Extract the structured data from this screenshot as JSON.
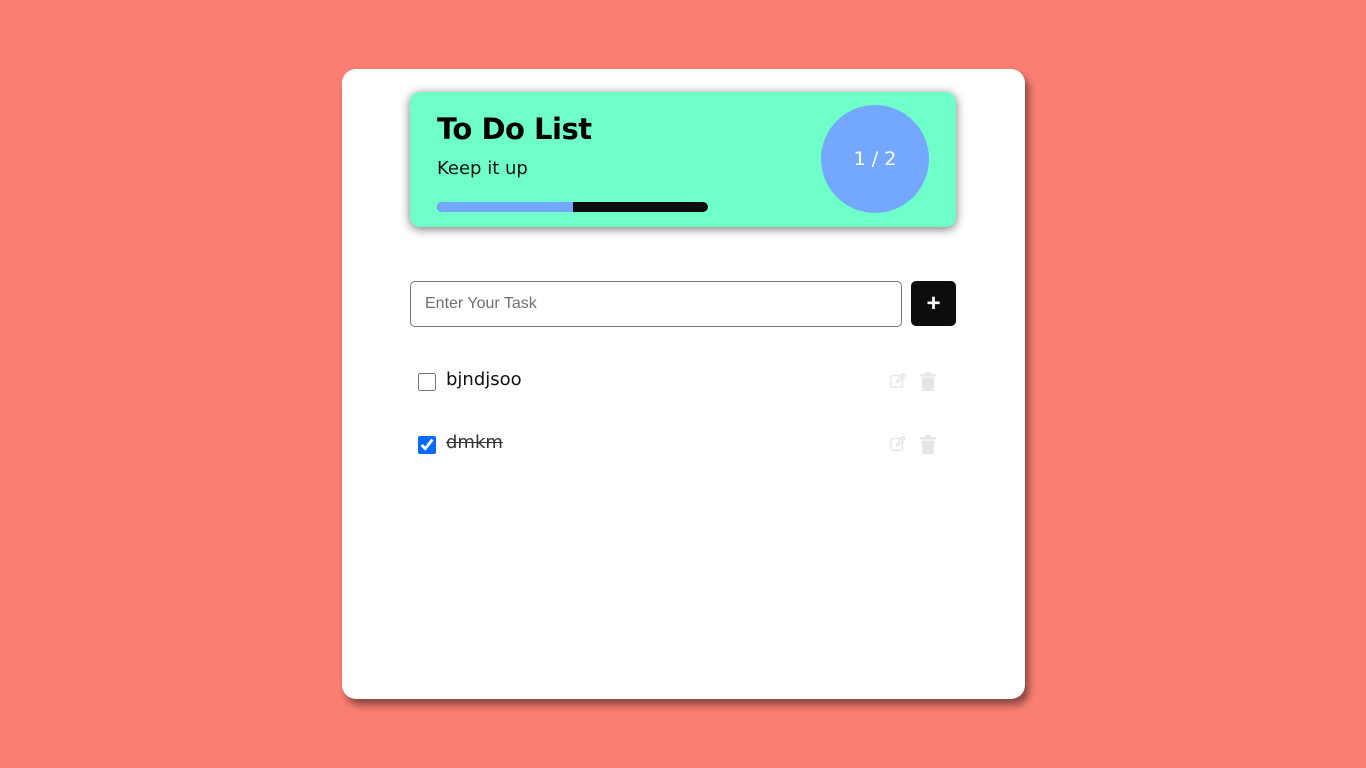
{
  "header": {
    "title": "To Do List",
    "subtitle": "Keep it up",
    "counter_text": "1 / 2",
    "progress_fraction": 0.5
  },
  "input": {
    "placeholder": "Enter Your Task",
    "value": ""
  },
  "add_button": {
    "label": "+"
  },
  "tasks": [
    {
      "text": "bjndjsoo",
      "completed": false
    },
    {
      "text": "dmkm",
      "completed": true
    }
  ],
  "icons": {
    "edit": "edit-icon",
    "delete": "trash-icon"
  },
  "colors": {
    "background": "#fa7f72",
    "header_bg": "#6fffc8",
    "accent_blue": "#74a7fe",
    "dark": "#0d0d0d",
    "icon_gray": "#e6e6e6"
  }
}
